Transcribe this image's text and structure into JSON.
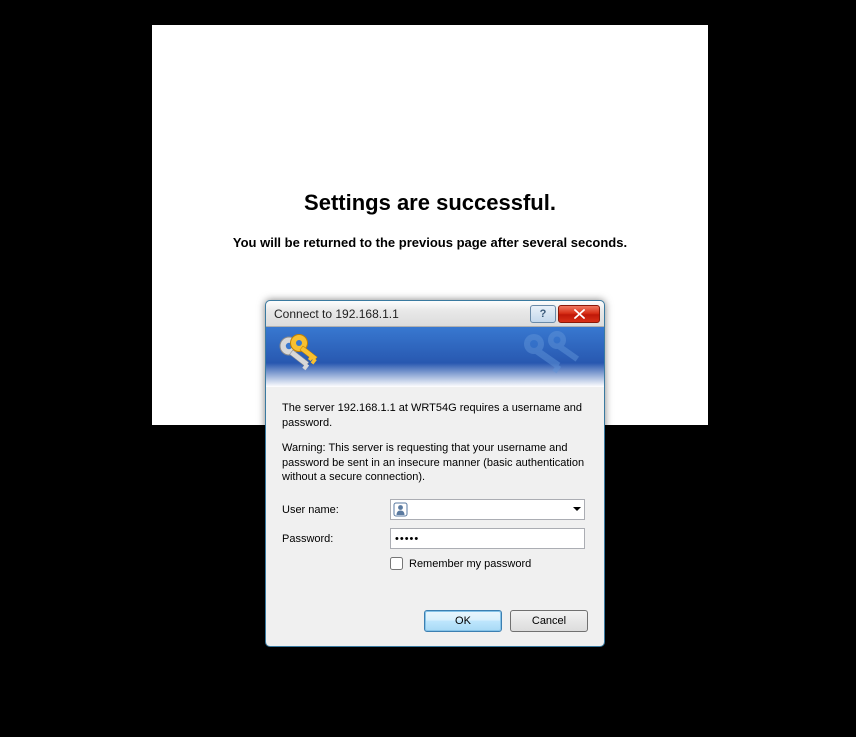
{
  "page": {
    "heading": "Settings are successful.",
    "subheading": "You will be returned to the previous page after several seconds."
  },
  "dialog": {
    "title": "Connect to 192.168.1.1",
    "message1": "The server 192.168.1.1 at WRT54G requires a username and password.",
    "message2": "Warning: This server is requesting that your username and password be sent in an insecure manner (basic authentication without a secure connection).",
    "username_label": "User name:",
    "username_value": "",
    "password_label": "Password:",
    "password_value": "•••••",
    "remember_label": "Remember my password",
    "ok_label": "OK",
    "cancel_label": "Cancel",
    "help_label": "?"
  }
}
